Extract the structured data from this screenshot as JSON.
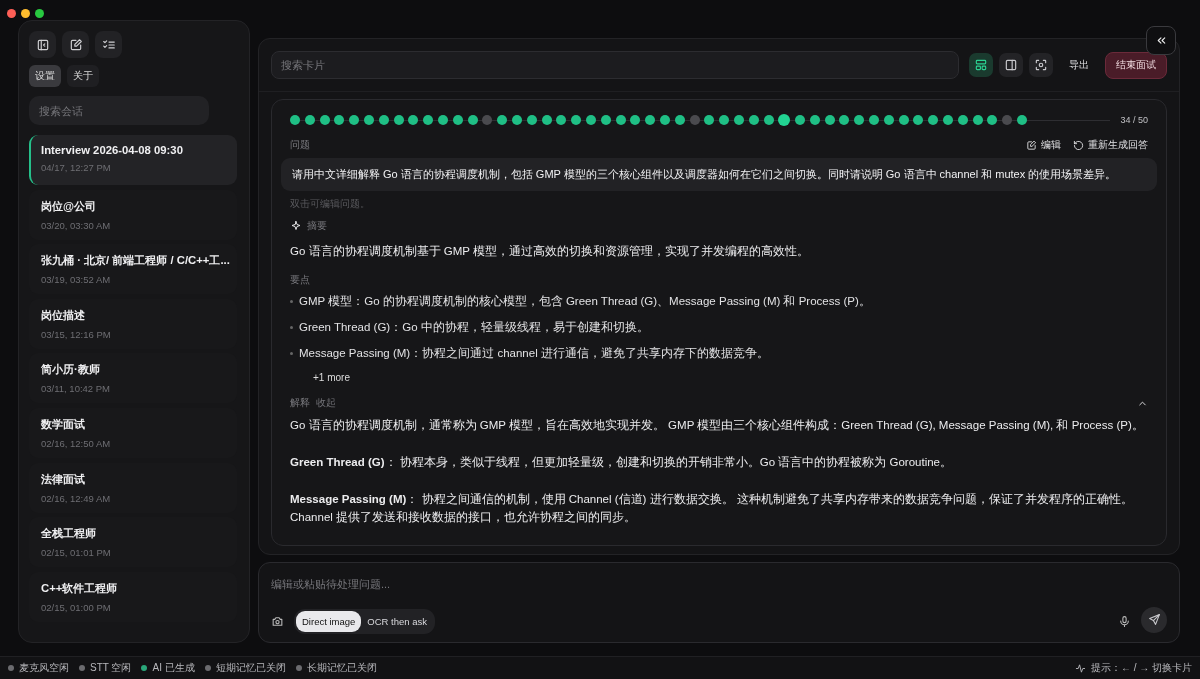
{
  "sidebar": {
    "tabs": [
      {
        "label": "设置",
        "selected": true
      },
      {
        "label": "关于",
        "selected": false
      }
    ],
    "search": {
      "placeholder": "搜索会话"
    },
    "sessions": [
      {
        "title": "Interview 2026-04-08 09:30",
        "time": "04/17, 12:27 PM",
        "selected": true
      },
      {
        "title": "岗位@公司",
        "time": "03/20, 03:30 AM",
        "selected": false
      },
      {
        "title": "张九桶 · 北京/ 前端工程师 / C/C++工...",
        "time": "03/19, 03:52 AM",
        "selected": false
      },
      {
        "title": "岗位描述",
        "time": "03/15, 12:16 PM",
        "selected": false
      },
      {
        "title": "简小历·教师",
        "time": "03/11, 10:42 PM",
        "selected": false
      },
      {
        "title": "数学面试",
        "time": "02/16, 12:50 AM",
        "selected": false
      },
      {
        "title": "法律面试",
        "time": "02/16, 12:49 AM",
        "selected": false
      },
      {
        "title": "全栈工程师",
        "time": "02/15, 01:01 PM",
        "selected": false
      },
      {
        "title": "C++软件工程师",
        "time": "02/15, 01:00 PM",
        "selected": false
      }
    ]
  },
  "toolbar": {
    "search": {
      "placeholder": "搜索卡片"
    },
    "views": [
      {
        "kind": "cards",
        "selected": true
      },
      {
        "kind": "split",
        "selected": false
      },
      {
        "kind": "capture",
        "selected": false
      }
    ],
    "export": "导出",
    "end": "结束面试"
  },
  "card": {
    "progress": {
      "dots": [
        {
          "answered": true,
          "selected": false
        },
        {
          "answered": true,
          "selected": false
        },
        {
          "answered": true,
          "selected": false
        },
        {
          "answered": true,
          "selected": false
        },
        {
          "answered": true,
          "selected": false
        },
        {
          "answered": true,
          "selected": false
        },
        {
          "answered": true,
          "selected": false
        },
        {
          "answered": true,
          "selected": false
        },
        {
          "answered": true,
          "selected": false
        },
        {
          "answered": true,
          "selected": false
        },
        {
          "answered": true,
          "selected": false
        },
        {
          "answered": true,
          "selected": false
        },
        {
          "answered": true,
          "selected": false
        },
        {
          "answered": false,
          "selected": false
        },
        {
          "answered": true,
          "selected": false
        },
        {
          "answered": true,
          "selected": false
        },
        {
          "answered": true,
          "selected": false
        },
        {
          "answered": true,
          "selected": false
        },
        {
          "answered": true,
          "selected": false
        },
        {
          "answered": true,
          "selected": false
        },
        {
          "answered": true,
          "selected": false
        },
        {
          "answered": true,
          "selected": false
        },
        {
          "answered": true,
          "selected": false
        },
        {
          "answered": true,
          "selected": false
        },
        {
          "answered": true,
          "selected": false
        },
        {
          "answered": true,
          "selected": false
        },
        {
          "answered": true,
          "selected": false
        },
        {
          "answered": false,
          "selected": false
        },
        {
          "answered": true,
          "selected": false
        },
        {
          "answered": true,
          "selected": false
        },
        {
          "answered": true,
          "selected": false
        },
        {
          "answered": true,
          "selected": false
        },
        {
          "answered": true,
          "selected": false
        },
        {
          "answered": true,
          "selected": true
        },
        {
          "answered": true,
          "selected": false
        },
        {
          "answered": true,
          "selected": false
        },
        {
          "answered": true,
          "selected": false
        },
        {
          "answered": true,
          "selected": false
        },
        {
          "answered": true,
          "selected": false
        },
        {
          "answered": true,
          "selected": false
        },
        {
          "answered": true,
          "selected": false
        },
        {
          "answered": true,
          "selected": false
        },
        {
          "answered": true,
          "selected": false
        },
        {
          "answered": true,
          "selected": false
        },
        {
          "answered": true,
          "selected": false
        },
        {
          "answered": true,
          "selected": false
        },
        {
          "answered": true,
          "selected": false
        },
        {
          "answered": true,
          "selected": false
        },
        {
          "answered": false,
          "selected": false
        },
        {
          "answered": true,
          "selected": false
        }
      ],
      "reading": "34 / 50"
    },
    "question_label": "问题",
    "edit": "编辑",
    "regenerate": "重新生成回答",
    "question": "请用中文详细解释 Go 语言的协程调度机制，包括 GMP 模型的三个核心组件以及调度器如何在它们之间切换。同时请说明 Go 语言中 channel 和 mutex 的使用场景差异。",
    "hint": "双击可编辑问题。",
    "summary_label": "摘要",
    "summary": "Go 语言的协程调度机制基于 GMP 模型，通过高效的切换和资源管理，实现了并发编程的高效性。",
    "points_label": "要点",
    "points": [
      "GMP 模型：Go 的协程调度机制的核心模型，包含 Green Thread (G)、Message Passing (M) 和 Process (P)。",
      "Green Thread (G)：Go 中的协程，轻量级线程，易于创建和切换。",
      "Message Passing (M)：协程之间通过 channel 进行通信，避免了共享内存下的数据竞争。"
    ],
    "more": "+1 more",
    "explanation_label": "解释",
    "collapse": "收起",
    "expanded": true,
    "explanation": [
      "Go 语言的协程调度机制，通常称为 GMP 模型，旨在高效地实现并发。 GMP 模型由三个核心组件构成：Green Thread (G), Message Passing (M), 和 Process (P)。",
      "**Green Thread (G)**： 协程本身，类似于线程，但更加轻量级，创建和切换的开销非常小。Go 语言中的协程被称为 Goroutine。",
      "**Message Passing (M)**： 协程之间通信的机制，使用 Channel (信道) 进行数据交换。 这种机制避免了共享内存带来的数据竞争问题，保证了并发程序的正确性。 Channel 提供了发送和接收数据的接口，也允许协程之间的同步。"
    ]
  },
  "composer": {
    "placeholder": "编辑或粘贴待处理问题...",
    "modes": [
      {
        "label": "Direct image",
        "selected": true
      },
      {
        "label": "OCR then ask",
        "selected": false
      }
    ]
  },
  "status_bar": {
    "items": [
      {
        "label": "麦克风空闲",
        "color": "#6b6b6f"
      },
      {
        "label": "STT 空闲",
        "color": "#6b6b6f"
      },
      {
        "label": "AI 已生成",
        "color": "#2aa77a"
      },
      {
        "label": "短期记忆已关闭",
        "color": "#6b6b6f"
      },
      {
        "label": "长期记忆已关闭",
        "color": "#6b6b6f"
      }
    ],
    "hint": "提示：← / → 切换卡片"
  }
}
